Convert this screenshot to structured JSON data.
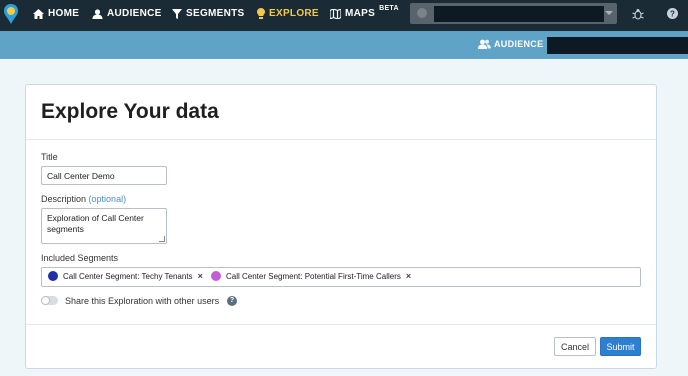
{
  "topnav": {
    "items": [
      {
        "label": "HOME",
        "icon": "home-icon"
      },
      {
        "label": "AUDIENCE",
        "icon": "audience-icon"
      },
      {
        "label": "SEGMENTS",
        "icon": "filter-icon"
      },
      {
        "label": "EXPLORE",
        "icon": "lightbulb-icon",
        "active": true
      },
      {
        "label": "MAPS",
        "icon": "map-icon",
        "badge": "BETA"
      }
    ],
    "active_color": "#f2c94c",
    "background": "#1b2b35"
  },
  "subbar": {
    "audience_label": "AUDIENCE",
    "background": "#5fa3c6"
  },
  "form": {
    "title": "Explore Your data",
    "title_label": "Title",
    "title_value": "Call Center Demo",
    "description_label": "Description",
    "description_optional": "(optional)",
    "description_value": "Exploration of Call Center segments",
    "segments_label": "Included Segments",
    "segments": [
      {
        "label": "Call Center Segment: Techy Tenants",
        "color": "#1f2fa8",
        "remove": "×"
      },
      {
        "label": "Call Center Segment: Potential First-Time Callers",
        "color": "#c160d6",
        "remove": "×"
      }
    ],
    "share_label": "Share this Exploration with other users",
    "help_glyph": "?",
    "cancel_label": "Cancel",
    "submit_label": "Submit",
    "submit_color": "#2f7fd0"
  }
}
